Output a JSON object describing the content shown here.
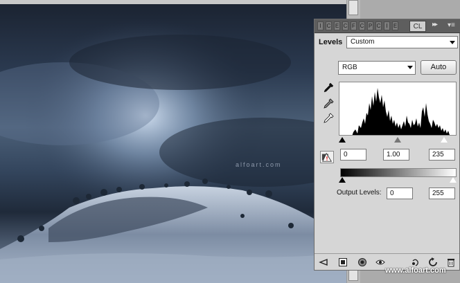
{
  "panel": {
    "tabs": {
      "icon_tabs": [
        "I",
        "C",
        "E",
        "C",
        "F",
        "C",
        "P",
        "C",
        "I",
        "E"
      ],
      "active_tab_label": "CL",
      "collapse_label": "▸▸",
      "menu_label": "▾≡"
    },
    "adjustment_label": "Levels",
    "preset_value": "Custom",
    "channel_value": "RGB",
    "auto_label": "Auto",
    "input_levels": {
      "black": "0",
      "gamma": "1.00",
      "white": "235"
    },
    "output_label": "Output Levels:",
    "output_levels": {
      "black": "0",
      "white": "255"
    },
    "histogram_levels_fraction": {
      "black": 0.0,
      "gamma": 0.5,
      "white": 0.92
    },
    "output_slider_fraction": {
      "black": 0.0,
      "white": 1.0
    }
  },
  "photo": {
    "small_watermark": "alfoart.com"
  },
  "watermark": "www.alfoart.com",
  "icons": {
    "eyedroppers": [
      "black-point-eyedropper-icon",
      "gray-point-eyedropper-icon",
      "white-point-eyedropper-icon"
    ],
    "bottom": [
      "return-arrow-icon",
      "clip-to-layer-icon",
      "mask-icon",
      "visibility-eye-icon",
      "previous-state-icon",
      "reset-icon",
      "trash-icon"
    ]
  }
}
